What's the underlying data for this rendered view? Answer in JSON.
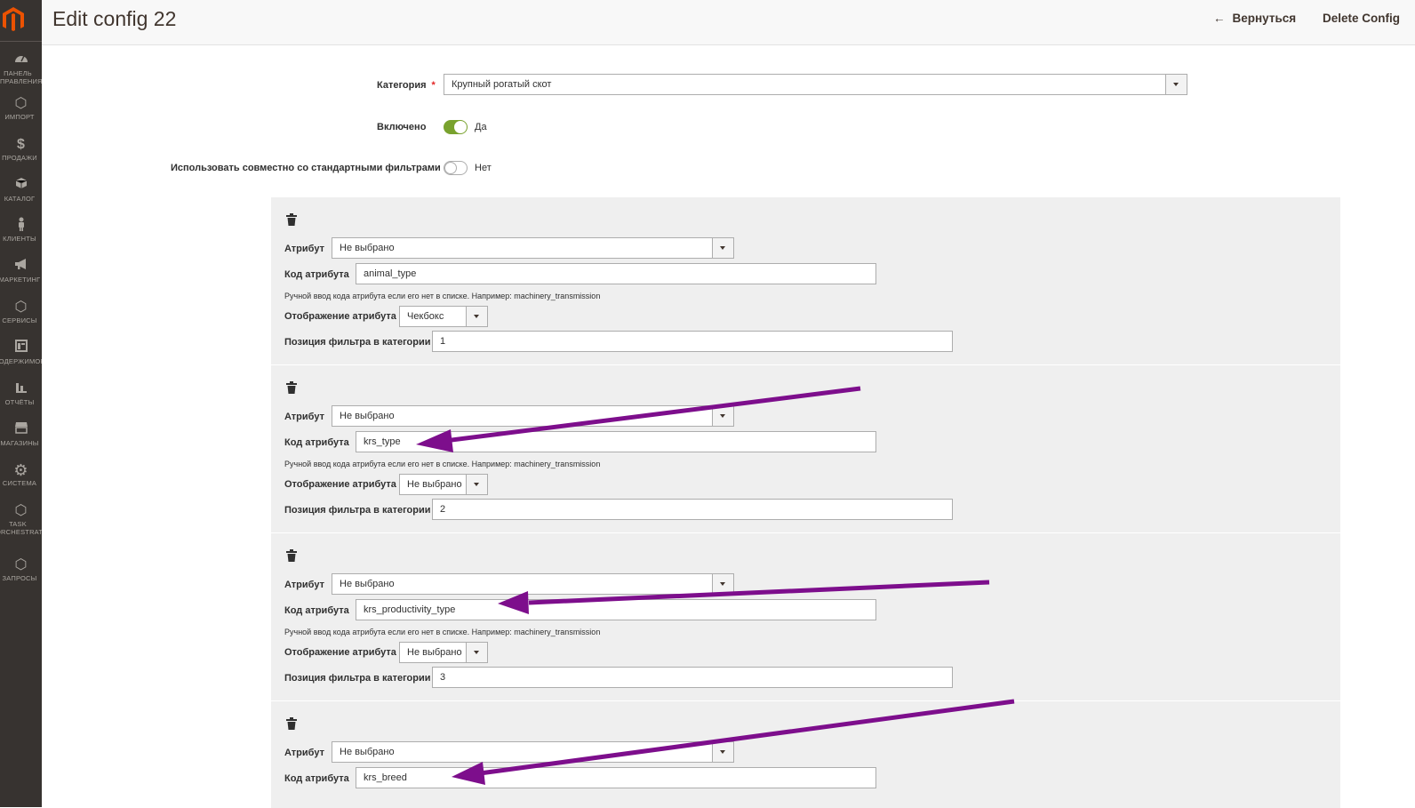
{
  "header": {
    "title": "Edit config 22",
    "back_label": "Вернуться",
    "delete_label": "Delete Config"
  },
  "sidebar": {
    "items": [
      {
        "label": "Панель управления",
        "icon": "dashboard-icon"
      },
      {
        "label": "Импорт",
        "icon": "hexagon-icon"
      },
      {
        "label": "Продажи",
        "icon": "dollar-icon"
      },
      {
        "label": "Каталог",
        "icon": "box-icon"
      },
      {
        "label": "Клиенты",
        "icon": "person-icon"
      },
      {
        "label": "Маркетинг",
        "icon": "megaphone-icon"
      },
      {
        "label": "Сервисы",
        "icon": "hexagon-icon"
      },
      {
        "label": "Содержимое",
        "icon": "layout-icon"
      },
      {
        "label": "Отчёты",
        "icon": "bar-chart-icon"
      },
      {
        "label": "Магазины",
        "icon": "store-icon"
      },
      {
        "label": "Система",
        "icon": "gear-icon"
      },
      {
        "label": "Task Orchestrator",
        "icon": "hexagon-icon"
      },
      {
        "label": "Запросы",
        "icon": "hexagon-icon"
      }
    ]
  },
  "form": {
    "category_label": "Категория",
    "category_value": "Крупный рогатый скот",
    "enabled_label": "Включено",
    "enabled_value": "Да",
    "use_with_standard_label": "Использовать совместно со стандартными фильтрами",
    "use_with_standard_value": "Нет"
  },
  "labels": {
    "attribute": "Атрибут",
    "attribute_code": "Код атрибута",
    "hint": "Ручной ввод кода атрибута если его нет в списке. Например: machinery_transmission",
    "display": "Отображение атрибута",
    "position": "Позиция фильтра в категории"
  },
  "filters": [
    {
      "attribute": "Не выбрано",
      "code": "animal_type",
      "display": "Чекбокс",
      "position": "1"
    },
    {
      "attribute": "Не выбрано",
      "code": "krs_type",
      "display": "Не выбрано",
      "position": "2"
    },
    {
      "attribute": "Не выбрано",
      "code": "krs_productivity_type",
      "display": "Не выбрано",
      "position": "3"
    },
    {
      "attribute": "Не выбрано",
      "code": "krs_breed"
    }
  ],
  "colors": {
    "sidebar": "#373330",
    "toggle_on": "#79a22e",
    "annotation_arrow": "#7d0e8c",
    "logo": "#eb5202"
  }
}
